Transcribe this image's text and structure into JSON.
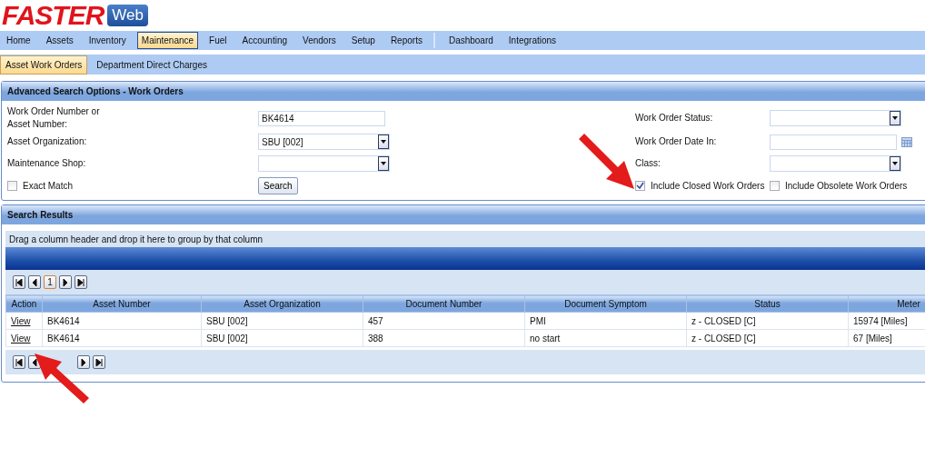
{
  "logo": {
    "brand": "FASTER",
    "product": "Web"
  },
  "menu": [
    {
      "kind": "item",
      "label": "Home",
      "selected": false
    },
    {
      "kind": "item",
      "label": "Assets",
      "selected": false
    },
    {
      "kind": "item",
      "label": "Inventory",
      "selected": false
    },
    {
      "kind": "item",
      "label": "Maintenance",
      "selected": true
    },
    {
      "kind": "item",
      "label": "Fuel",
      "selected": false
    },
    {
      "kind": "item",
      "label": "Accounting",
      "selected": false
    },
    {
      "kind": "item",
      "label": "Vendors",
      "selected": false
    },
    {
      "kind": "item",
      "label": "Setup",
      "selected": false
    },
    {
      "kind": "item",
      "label": "Reports",
      "selected": false
    },
    {
      "kind": "separator"
    },
    {
      "kind": "item",
      "label": "Dashboard",
      "selected": false
    },
    {
      "kind": "item",
      "label": "Integrations",
      "selected": false
    }
  ],
  "submenu": [
    {
      "label": "Asset Work Orders",
      "selected": true
    },
    {
      "label": "Department Direct Charges",
      "selected": false
    }
  ],
  "search_panel": {
    "title": "Advanced Search Options - Work Orders",
    "left_fields": [
      {
        "kind": "text",
        "label": "Work Order Number or\nAsset Number:",
        "value": "BK4614"
      },
      {
        "kind": "select",
        "label": "Asset Organization:",
        "value": "SBU [002]"
      },
      {
        "kind": "select",
        "label": "Maintenance Shop:"
      }
    ],
    "right_fields": [
      {
        "kind": "select",
        "label": "Work Order Status:"
      },
      {
        "kind": "date",
        "label": "Work Order Date In:"
      },
      {
        "kind": "select",
        "label": "Class:"
      }
    ],
    "exact_match": {
      "label": "Exact Match",
      "checked": false
    },
    "search_button": "Search",
    "options": [
      {
        "label": "Include Closed Work Orders",
        "checked": true
      },
      {
        "label": "Include Obsolete Work Orders",
        "checked": false
      }
    ]
  },
  "results": {
    "title": "Search Results",
    "group_hint": "Drag a column header and drop it here to group by that column",
    "pages": [
      {
        "label": "1",
        "selected": true
      }
    ],
    "columns": [
      "Action",
      "Asset Number",
      "Asset Organization",
      "Document Number",
      "Document Symptom",
      "Status",
      "Meter"
    ],
    "rows": [
      {
        "cells": [
          "View",
          "BK4614",
          "SBU [002]",
          "457",
          "PMI",
          "z - CLOSED [C]",
          "15974 [Miles]"
        ]
      },
      {
        "cells": [
          "View",
          "BK4614",
          "SBU [002]",
          "388",
          "no start",
          "z - CLOSED [C]",
          "67 [Miles]"
        ]
      }
    ]
  }
}
